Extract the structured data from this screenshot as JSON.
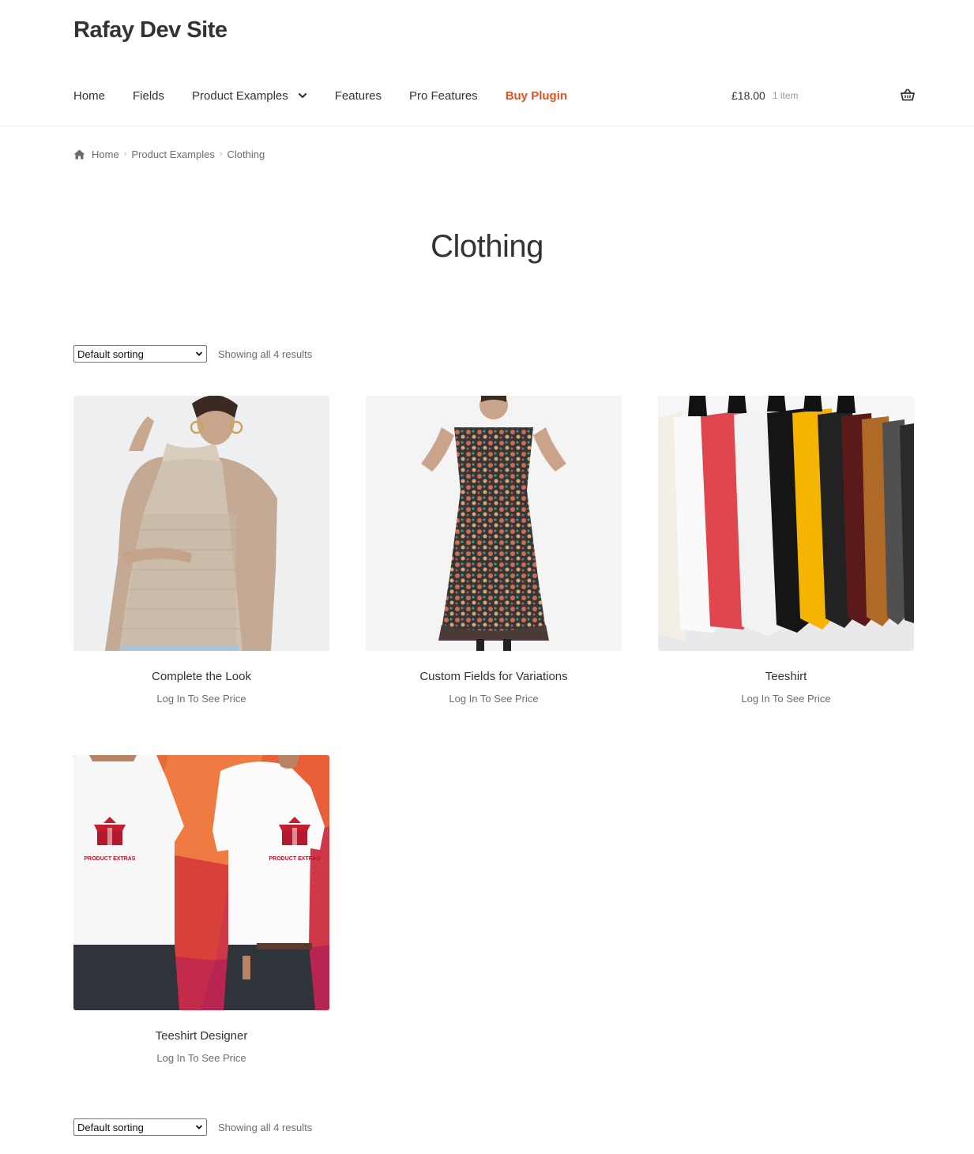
{
  "site": {
    "title": "Rafay Dev Site"
  },
  "nav": {
    "items": [
      {
        "label": "Home"
      },
      {
        "label": "Fields"
      },
      {
        "label": "Product Examples"
      },
      {
        "label": "Features"
      },
      {
        "label": "Pro Features"
      },
      {
        "label": "Buy Plugin"
      }
    ],
    "accent_color": "#e2541c"
  },
  "cart": {
    "amount": "£18.00",
    "count": "1 item",
    "icon": "basket-icon"
  },
  "breadcrumb": {
    "items": [
      "Home",
      "Product Examples",
      "Clothing"
    ],
    "icon": "home-icon"
  },
  "page": {
    "title": "Clothing"
  },
  "sorting": {
    "selected": "Default sorting",
    "result_count": "Showing all 4 results"
  },
  "products": [
    {
      "name": "Complete the Look",
      "price_text": "Log In To See Price"
    },
    {
      "name": "Custom Fields for Variations",
      "price_text": "Log In To See Price"
    },
    {
      "name": "Teeshirt",
      "price_text": "Log In To See Price"
    },
    {
      "name": "Teeshirt Designer",
      "price_text": "Log In To See Price",
      "print_text": "PRODUCT EXTRAS"
    }
  ]
}
